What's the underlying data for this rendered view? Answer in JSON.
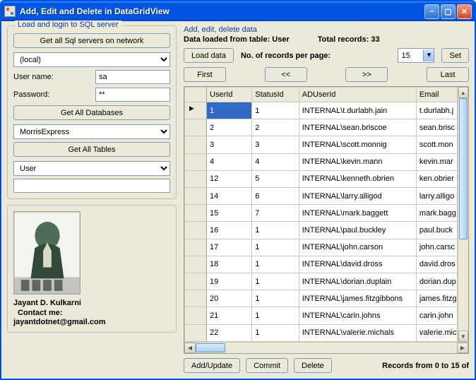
{
  "window": {
    "title": "Add, Edit and Delete in DataGridView"
  },
  "left": {
    "group_title": "Load and login to SQL server",
    "get_servers": "Get all Sql servers  on network",
    "server": "(local)",
    "username_label": "User name:",
    "username": "sa",
    "password_label": "Password:",
    "password": "**",
    "get_databases": "Get All Databases",
    "database": "MorrisExpress",
    "get_tables": "Get All Tables",
    "table": "User"
  },
  "author": {
    "name": "Jayant D. Kulkarni",
    "contact_label": "Contact me:",
    "email": "jayantdotnet@gmail.com"
  },
  "right": {
    "section_title": "Add, edit, delete data",
    "loaded_label": "Data loaded from table: ",
    "loaded_table": "User",
    "total_label": "Total records: ",
    "total_records": "33",
    "load_data": "Load data",
    "per_page_label": "No. of records per page:",
    "per_page_value": "15",
    "set": "Set",
    "first": "First",
    "prev": "<<",
    "next": ">>",
    "last": "Last",
    "add_update": "Add/Update",
    "commit": "Commit",
    "delete": "Delete",
    "records_status": "Records from 0 to 15 of"
  },
  "grid": {
    "headers": [
      "UserId",
      "StatusId",
      "ADUserId",
      "Email"
    ],
    "rows": [
      {
        "UserId": "1",
        "StatusId": "1",
        "ADUserId": "INTERNAL\\t.durlabh.jain",
        "Email": "t.durlabh.j"
      },
      {
        "UserId": "2",
        "StatusId": "2",
        "ADUserId": "INTERNAL\\sean.briscoe",
        "Email": "sean.brisc"
      },
      {
        "UserId": "3",
        "StatusId": "3",
        "ADUserId": "INTERNAL\\scott.monnig",
        "Email": "scott.mon"
      },
      {
        "UserId": "4",
        "StatusId": "4",
        "ADUserId": "INTERNAL\\kevin.mann",
        "Email": "kevin.mar"
      },
      {
        "UserId": "12",
        "StatusId": "5",
        "ADUserId": "INTERNAL\\kenneth.obrien",
        "Email": "ken.obrier"
      },
      {
        "UserId": "14",
        "StatusId": "6",
        "ADUserId": "INTERNAL\\larry.alligod",
        "Email": "larry.alligo"
      },
      {
        "UserId": "15",
        "StatusId": "7",
        "ADUserId": "INTERNAL\\mark.baggett",
        "Email": "mark.bagg"
      },
      {
        "UserId": "16",
        "StatusId": "1",
        "ADUserId": "INTERNAL\\paul.buckley",
        "Email": "paul.buck"
      },
      {
        "UserId": "17",
        "StatusId": "1",
        "ADUserId": "INTERNAL\\john.carson",
        "Email": "john.carsc"
      },
      {
        "UserId": "18",
        "StatusId": "1",
        "ADUserId": "INTERNAL\\david.dross",
        "Email": "david.dros"
      },
      {
        "UserId": "19",
        "StatusId": "1",
        "ADUserId": "INTERNAL\\dorian.duplain",
        "Email": "dorian.dup"
      },
      {
        "UserId": "20",
        "StatusId": "1",
        "ADUserId": "INTERNAL\\james.fitzgibbons",
        "Email": "james.fitzg"
      },
      {
        "UserId": "21",
        "StatusId": "1",
        "ADUserId": "INTERNAL\\carin.johns",
        "Email": "carin.john"
      },
      {
        "UserId": "22",
        "StatusId": "1",
        "ADUserId": "INTERNAL\\valerie.michals",
        "Email": "valerie.mic"
      }
    ]
  }
}
